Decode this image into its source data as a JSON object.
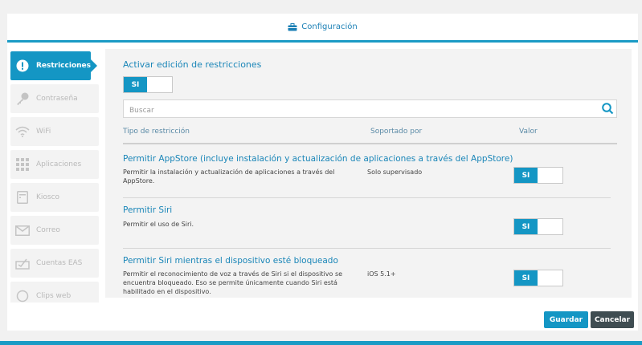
{
  "header": {
    "title": "Configuración",
    "icon": "briefcase-icon"
  },
  "sidebar": {
    "items": [
      {
        "label": "Restricciones",
        "icon": "exclamation-icon",
        "active": true
      },
      {
        "label": "Contraseña",
        "icon": "key-icon"
      },
      {
        "label": "WiFi",
        "icon": "wifi-icon"
      },
      {
        "label": "Aplicaciones",
        "icon": "grid-icon"
      },
      {
        "label": "Kiosco",
        "icon": "kiosk-icon"
      },
      {
        "label": "Correo",
        "icon": "mail-icon"
      },
      {
        "label": "Cuentas EAS",
        "icon": "eas-icon"
      },
      {
        "label": "Clips web",
        "icon": "clip-icon"
      }
    ]
  },
  "main": {
    "enable_label": "Activar edición de restricciones",
    "enable_toggle": "SI",
    "search_placeholder": "Buscar",
    "columns": {
      "type": "Tipo de restricción",
      "supported": "Soportado por",
      "value": "Valor"
    },
    "rows": [
      {
        "title": "Permitir AppStore (incluye instalación y actualización de aplicaciones a través del AppStore)",
        "description": "Permitir la instalación y actualización de aplicaciones a través del AppStore.",
        "supported": "Solo supervisado",
        "value": "SI"
      },
      {
        "title": "Permitir Siri",
        "description": "Permitir el uso de Siri.",
        "supported": "",
        "value": "SI"
      },
      {
        "title": "Permitir Siri mientras el dispositivo esté bloqueado",
        "description": "Permitir el reconocimiento de voz a través de Siri si el dispositivo se encuentra bloqueado. Eso se permite únicamente cuando Siri está habilitado en el dispositivo.",
        "supported": "iOS 5.1+",
        "value": "SI"
      }
    ]
  },
  "footer": {
    "save_label": "Guardar",
    "cancel_label": "Cancelar"
  },
  "colors": {
    "accent": "#1496c4",
    "cancel": "#3f4d52"
  }
}
